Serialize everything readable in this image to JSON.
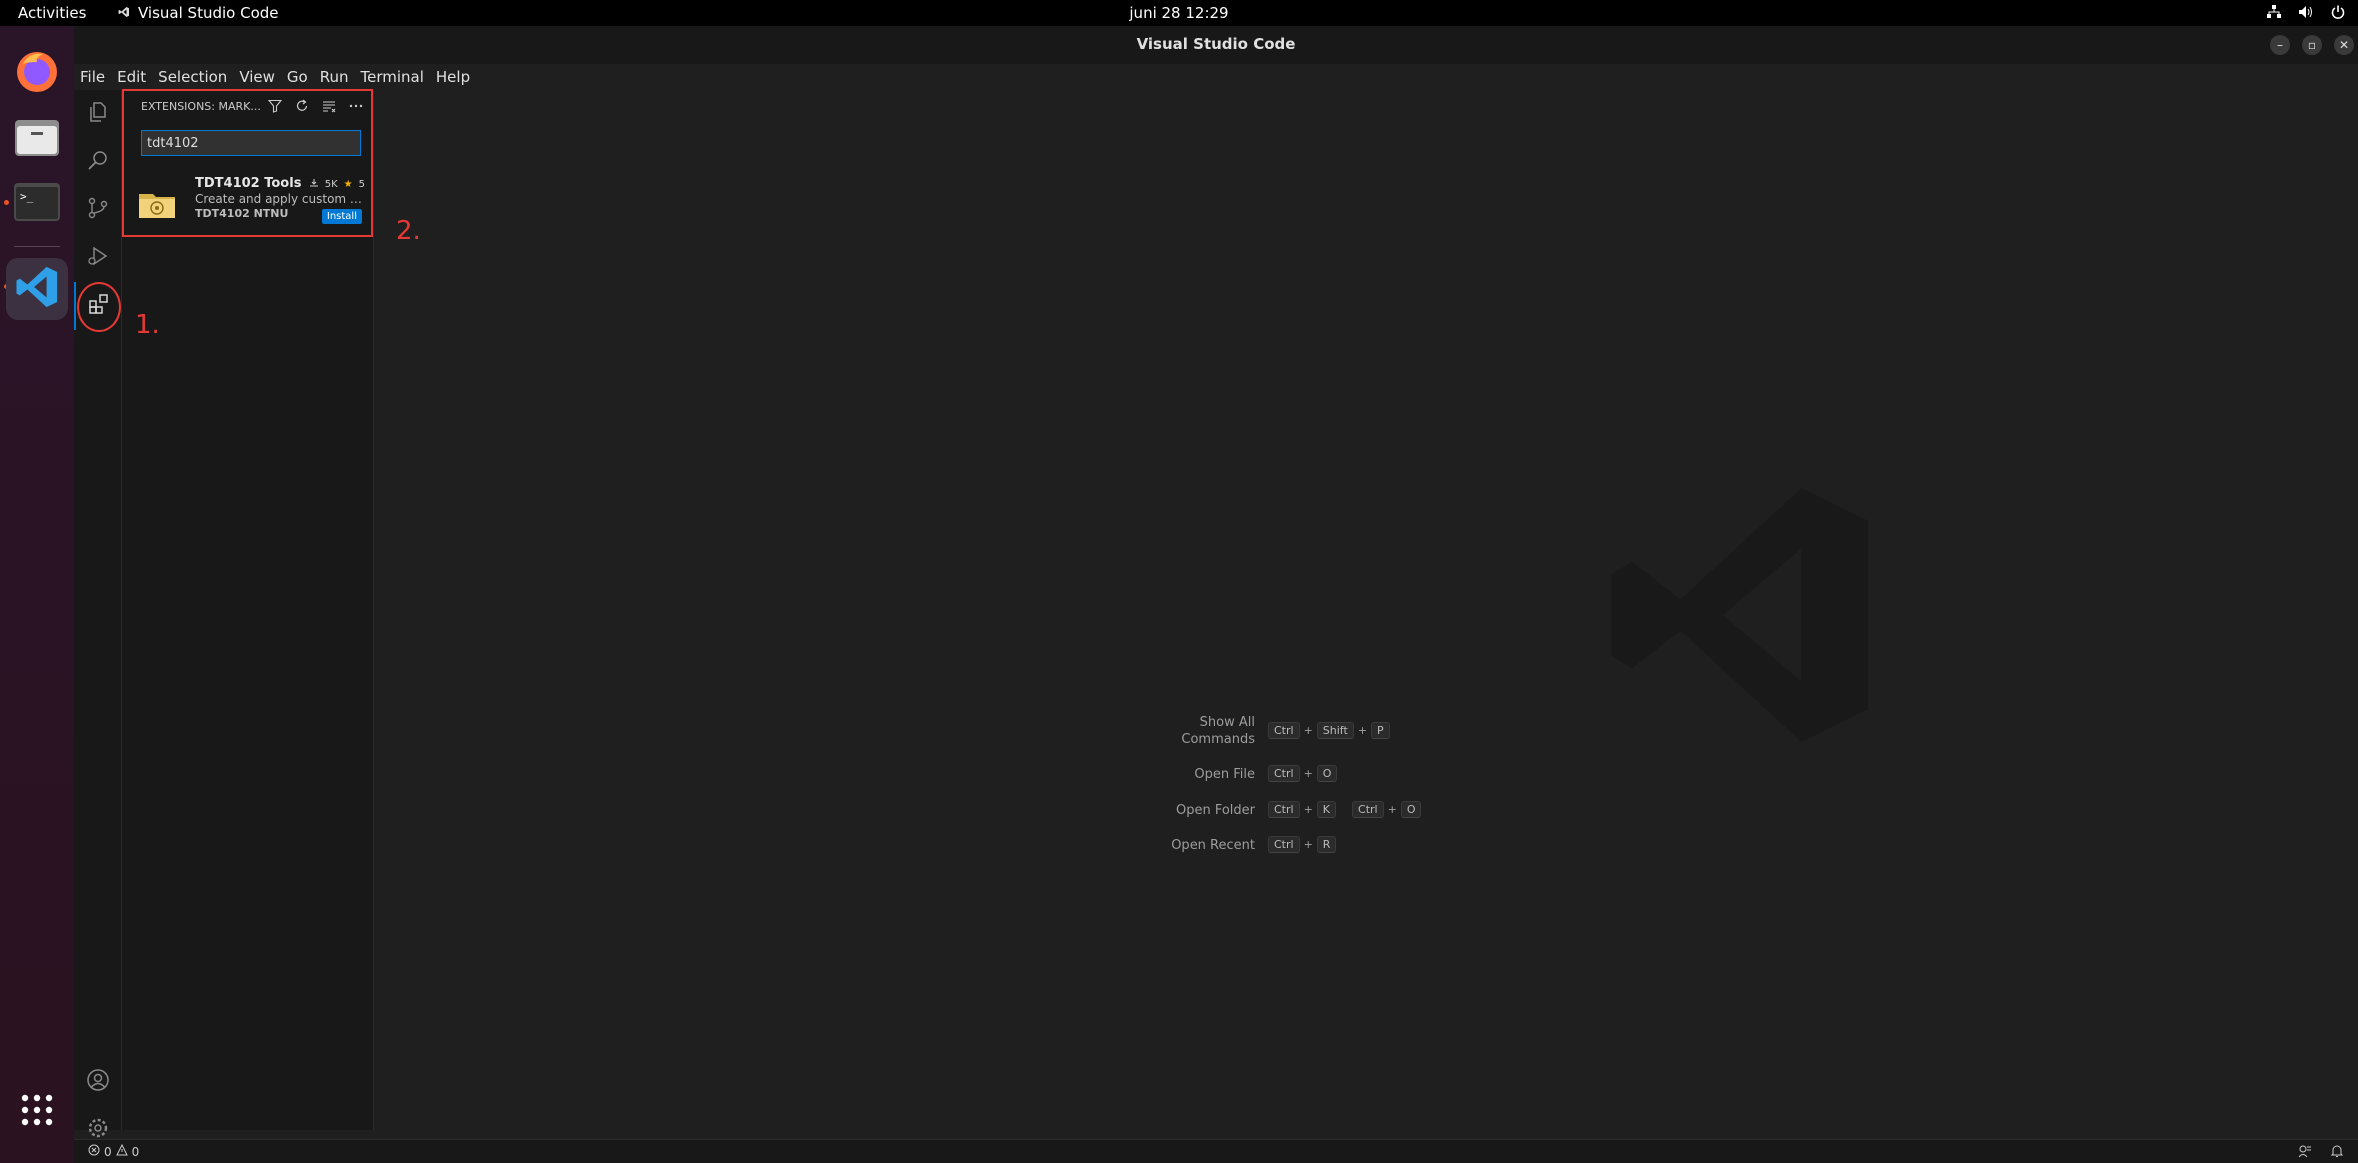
{
  "topbar": {
    "activities": "Activities",
    "app_name": "Visual Studio Code",
    "clock": "juni 28  12:29"
  },
  "window": {
    "title": "Visual Studio Code"
  },
  "menu": [
    "File",
    "Edit",
    "Selection",
    "View",
    "Go",
    "Run",
    "Terminal",
    "Help"
  ],
  "sidebar": {
    "header": "EXTENSIONS: MARK...",
    "search_value": "tdt4102",
    "extension": {
      "name": "TDT4102 Tools",
      "downloads": "5K",
      "rating": "5",
      "description": "Create and apply custom p...",
      "publisher": "TDT4102 NTNU",
      "install_label": "Install"
    }
  },
  "annotations": {
    "label1": "1.",
    "label2": "2."
  },
  "editor": {
    "shortcuts": [
      {
        "label_line1": "Show All",
        "label_line2": "Commands",
        "keys": [
          "Ctrl",
          "+",
          "Shift",
          "+",
          "P"
        ]
      },
      {
        "label_line1": "Open File",
        "keys": [
          "Ctrl",
          "+",
          "O"
        ]
      },
      {
        "label_line1": "Open Folder",
        "keys": [
          "Ctrl",
          "+",
          "K",
          "Ctrl",
          "+",
          "O"
        ]
      },
      {
        "label_line1": "Open Recent",
        "keys": [
          "Ctrl",
          "+",
          "R"
        ]
      }
    ]
  },
  "statusbar": {
    "errors": "0",
    "warnings": "0"
  },
  "colors": {
    "accent": "#0078d4",
    "annotation": "#e53935",
    "ubuntu_orange": "#e95420"
  }
}
